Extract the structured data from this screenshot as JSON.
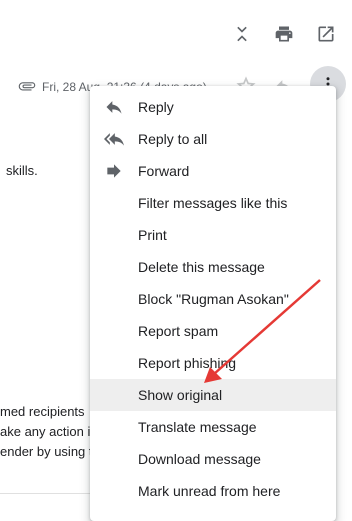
{
  "toolbar": {
    "icons": [
      "collapse-icon",
      "print-icon",
      "open-in-new-window-icon"
    ]
  },
  "message": {
    "date": "Fri, 28 Aug, 21:36 (4 days ago)",
    "body_lines": [
      "skills.",
      "med recipients",
      "ake any action in",
      "ender by using th"
    ]
  },
  "menu": {
    "items": [
      {
        "label": "Reply",
        "icon": "reply-icon"
      },
      {
        "label": "Reply to all",
        "icon": "reply-all-icon"
      },
      {
        "label": "Forward",
        "icon": "forward-icon"
      },
      {
        "label": "Filter messages like this"
      },
      {
        "label": "Print"
      },
      {
        "label": "Delete this message"
      },
      {
        "label": "Block \"Rugman Asokan\""
      },
      {
        "label": "Report spam"
      },
      {
        "label": "Report phishing"
      },
      {
        "label": "Show original",
        "highlighted": true
      },
      {
        "label": "Translate message"
      },
      {
        "label": "Download message"
      },
      {
        "label": "Mark unread from here"
      }
    ]
  },
  "colors": {
    "annotation_arrow": "#e53935",
    "highlight": "#eeeeee",
    "more_button_bg": "#dadce0"
  }
}
